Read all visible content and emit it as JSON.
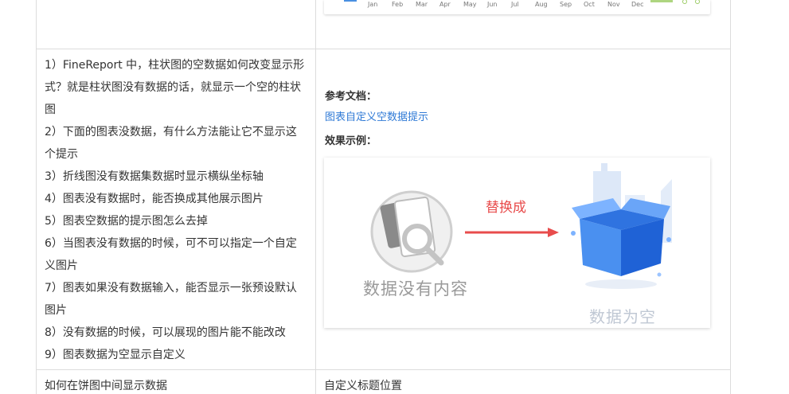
{
  "top_chart": {
    "months": [
      "Jan",
      "Feb",
      "Mar",
      "Apr",
      "May",
      "Jun",
      "Jul",
      "Aug",
      "Sep",
      "Oct",
      "Nov",
      "Dec"
    ]
  },
  "questions": [
    "1）FineReport 中，柱状图的空数据如何改变显示形",
    "式？就是柱状图没有数据的话，就显示一个空的柱状",
    "图",
    "2）下面的图表没数据，有什么方法能让它不显示这",
    "个提示",
    "3）折线图没有数据集数据时显示横纵坐标轴",
    "4）图表没有数据时，能否换成其他展示图片",
    "5）图表空数据的提示图怎么去掉",
    "6）当图表没有数据的时候，可不可以指定一个自定",
    "义图片",
    "7）图表如果没有数据输入，能否显示一张预设默认",
    "图片",
    "8）没有数据的时候，可以展现的图片能不能改改",
    "9）图表数据为空显示自定义"
  ],
  "answer": {
    "ref_label": "参考文档：",
    "ref_link": "图表自定义空数据提示",
    "example_label": "效果示例："
  },
  "example_image": {
    "left_caption": "数据没有内容",
    "arrow_text": "替换成",
    "right_caption": "数据为空",
    "arrow_color": "#e84c4c",
    "box_color": "#3b82f6"
  },
  "next_row": {
    "left": "如何在饼图中间显示数据",
    "right": "自定义标题位置"
  }
}
